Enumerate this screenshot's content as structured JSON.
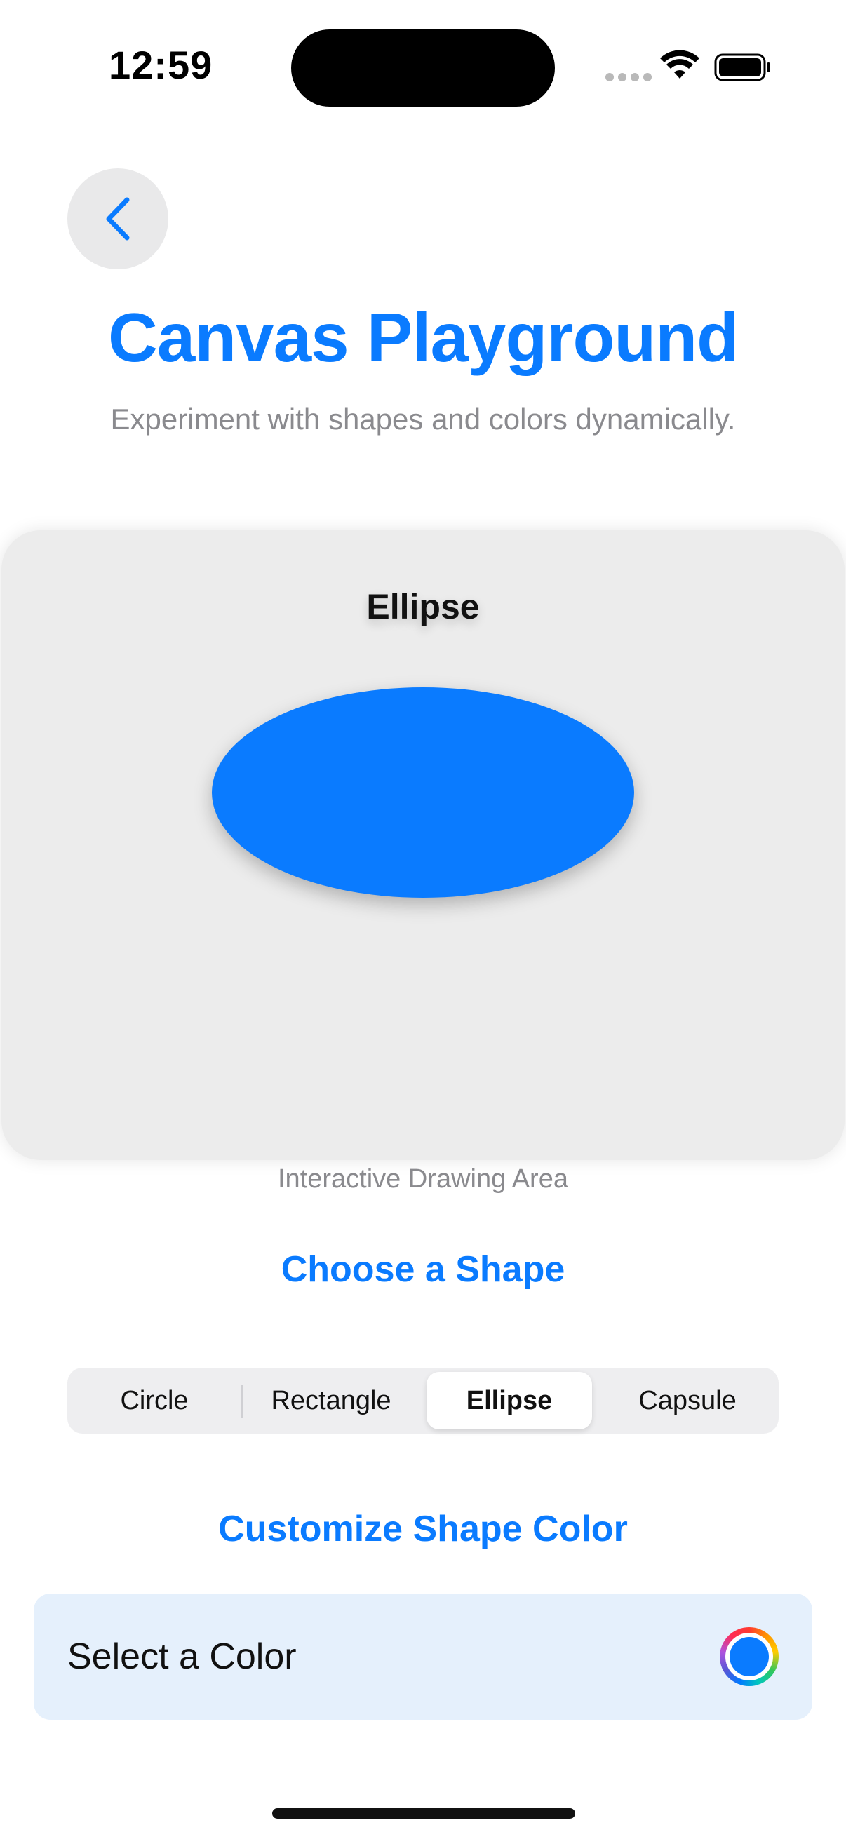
{
  "status_bar": {
    "time": "12:59"
  },
  "nav": {
    "back_icon": "chevron-left-icon"
  },
  "header": {
    "title": "Canvas Playground",
    "subtitle": "Experiment with shapes and colors dynamically."
  },
  "canvas": {
    "shape_label": "Ellipse",
    "caption": "Interactive Drawing Area"
  },
  "shape_picker": {
    "heading": "Choose a Shape",
    "options": [
      "Circle",
      "Rectangle",
      "Ellipse",
      "Capsule"
    ],
    "selected": "Ellipse"
  },
  "color_picker": {
    "heading": "Customize Shape Color",
    "label": "Select a Color"
  },
  "colors": {
    "accent": "#0a7bff",
    "shape_fill": "#0a7bff",
    "row_background": "#e5f0fc"
  }
}
